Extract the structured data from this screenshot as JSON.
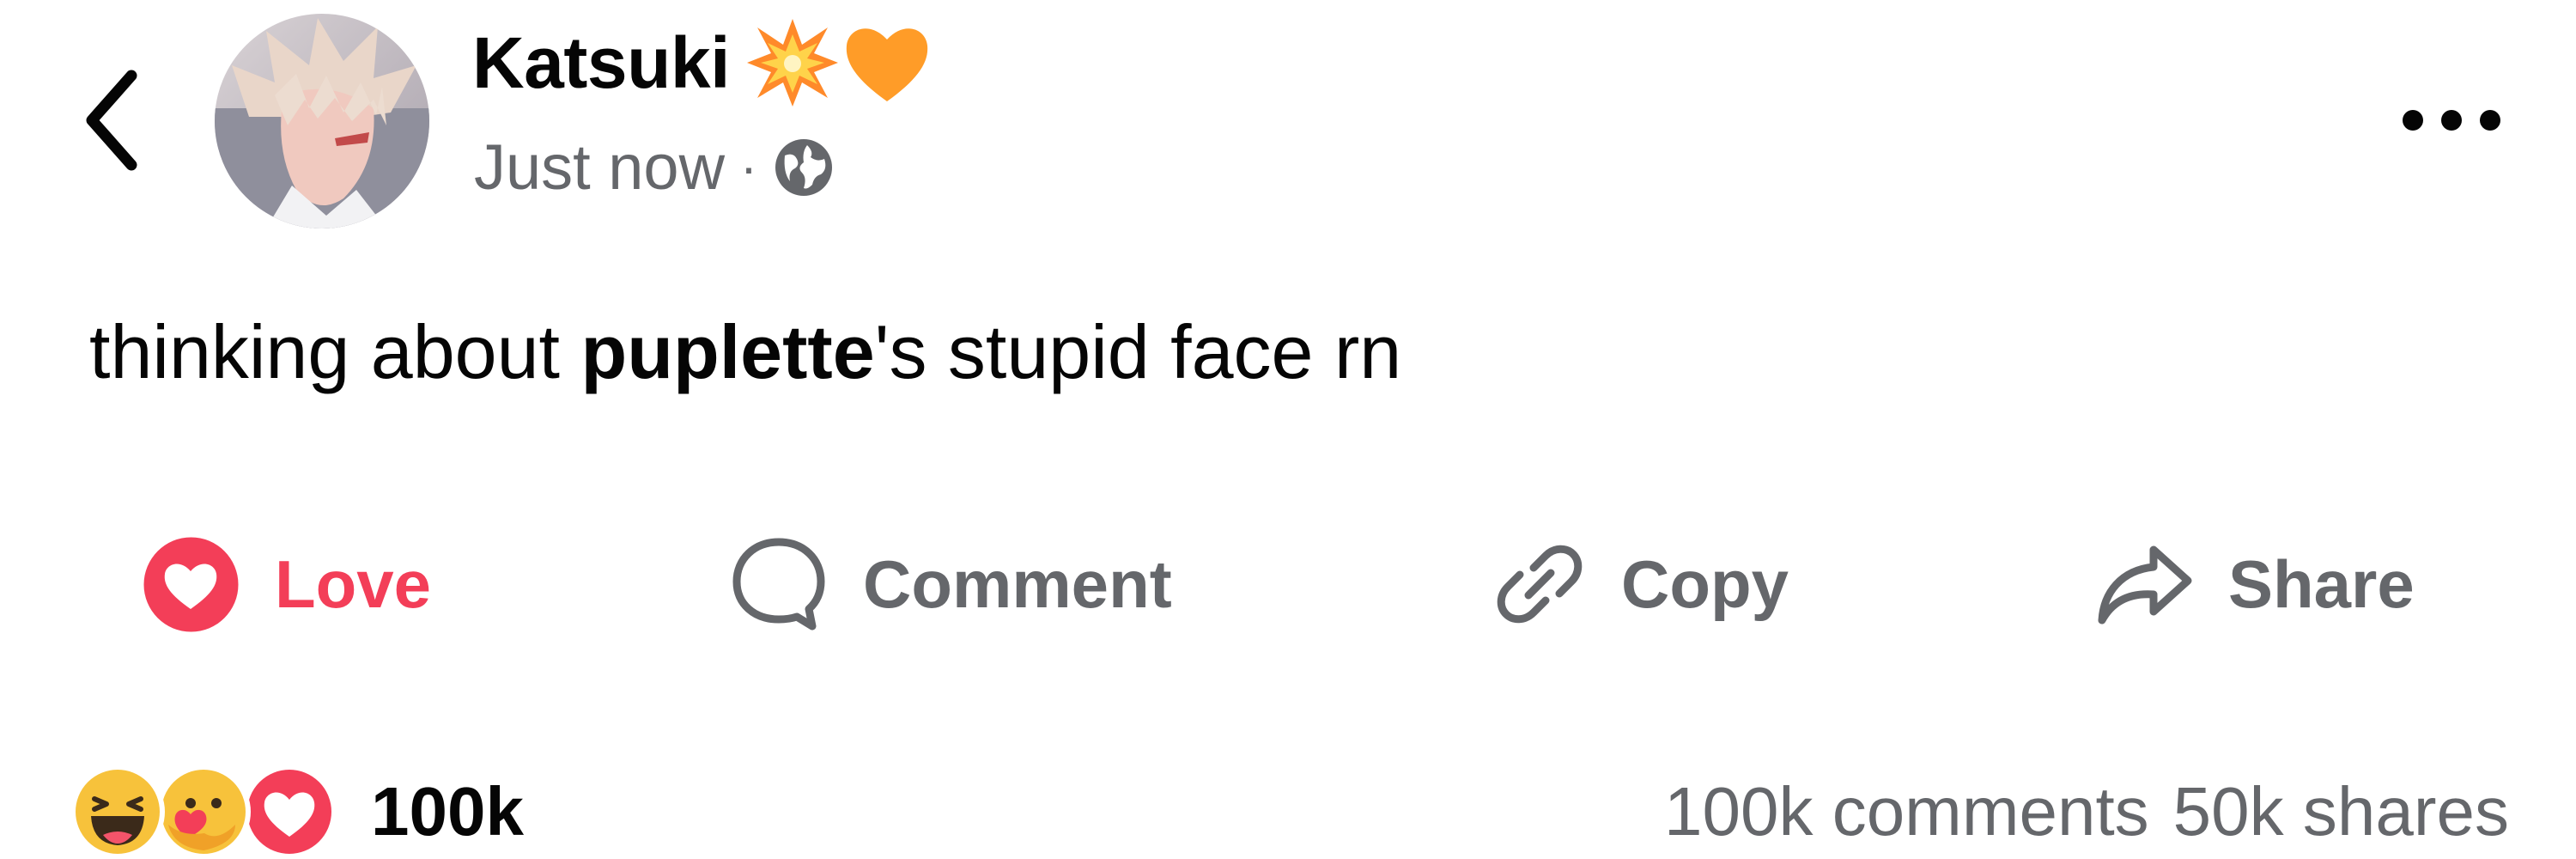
{
  "header": {
    "back_icon": "chevron-left-icon",
    "author": {
      "name": "Katsuki",
      "name_emojis": [
        "collision-icon",
        "orange-heart-icon"
      ],
      "avatar": "avatar-image"
    },
    "timestamp": "Just now",
    "separator": "·",
    "privacy_icon": "globe-icon",
    "more_icon": "more-horizontal-icon"
  },
  "post": {
    "text_before": "thinking about ",
    "mention": "puplette",
    "text_after": "'s stupid face rn"
  },
  "actions": {
    "love": {
      "label": "Love",
      "icon": "heart-icon"
    },
    "comment": {
      "label": "Comment",
      "icon": "comment-icon"
    },
    "copy": {
      "label": "Copy",
      "icon": "link-icon"
    },
    "share": {
      "label": "Share",
      "icon": "share-icon"
    }
  },
  "engagement": {
    "reaction_icons": [
      "haha-icon",
      "care-icon",
      "love-icon"
    ],
    "reaction_count": "100k",
    "comments": "100k comments",
    "shares": "50k shares"
  },
  "colors": {
    "love": "#f33e58",
    "secondary_text": "#65676b",
    "primary_text": "#050505",
    "orange_heart": "#ff9c28",
    "haha_yellow": "#f7c23b"
  }
}
